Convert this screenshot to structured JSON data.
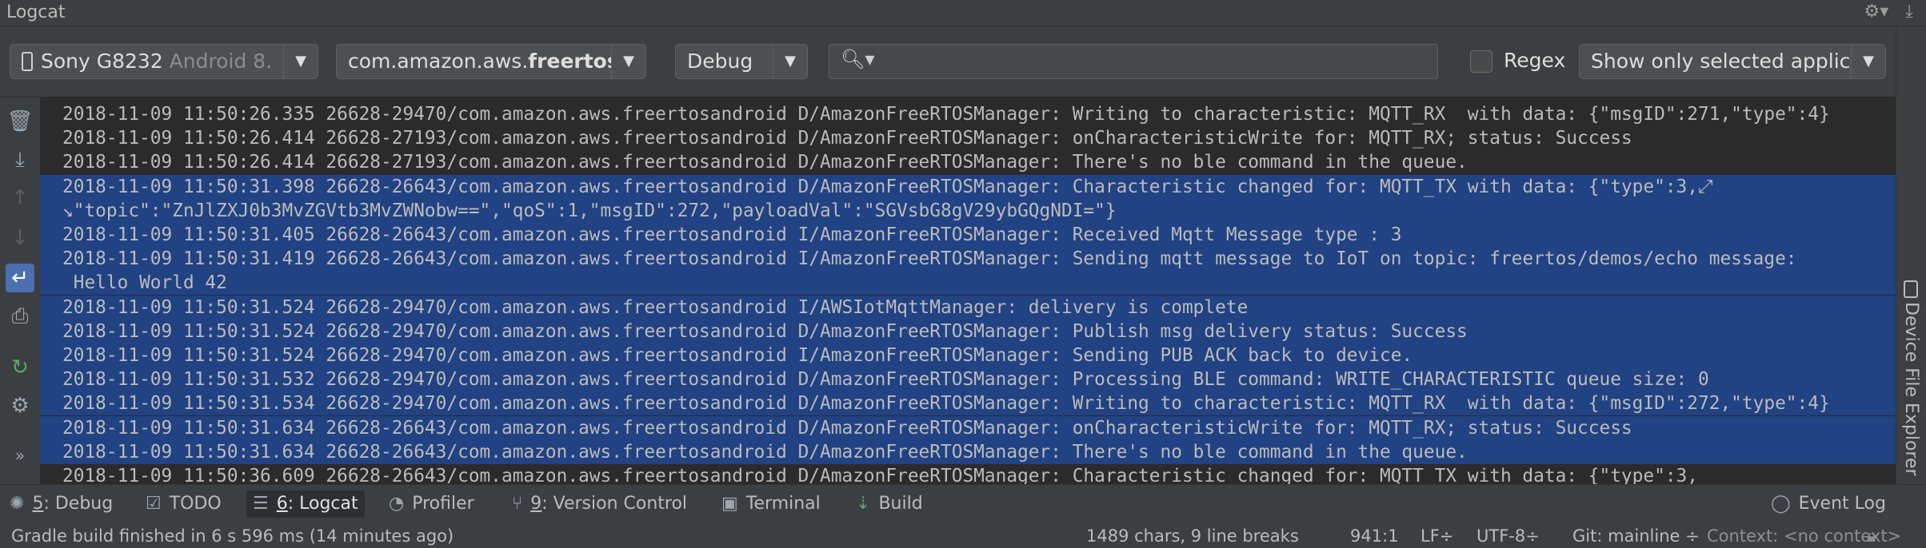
{
  "window": {
    "title": "Logcat"
  },
  "filters": {
    "device": {
      "name": "Sony G8232",
      "api": "Android 8."
    },
    "process": {
      "prefix": "com.amazon.aws.",
      "bold": "freertos"
    },
    "level": "Debug",
    "search_placeholder": "",
    "regex_label": "Regex",
    "scope": "Show only selected applica"
  },
  "log_lines": [
    {
      "text": "2018-11-09 11:50:26.335 26628-29470/com.amazon.aws.freertosandroid D/AmazonFreeRTOSManager: Writing to characteristic: MQTT_RX  with data: {\"msgID\":271,\"type\":4}",
      "selected": false
    },
    {
      "text": "2018-11-09 11:50:26.414 26628-27193/com.amazon.aws.freertosandroid D/AmazonFreeRTOSManager: onCharacteristicWrite for: MQTT_RX; status: Success",
      "selected": false
    },
    {
      "text": "2018-11-09 11:50:26.414 26628-27193/com.amazon.aws.freertosandroid D/AmazonFreeRTOSManager: There's no ble command in the queue.",
      "selected": false
    },
    {
      "text": "2018-11-09 11:50:31.398 26628-26643/com.amazon.aws.freertosandroid D/AmazonFreeRTOSManager: Characteristic changed for: MQTT_TX with data: {\"type\":3,⤢",
      "selected": true
    },
    {
      "text": "↘\"topic\":\"ZnJlZXJ0b3MvZGVtb3MvZWNobw==\",\"qoS\":1,\"msgID\":272,\"payloadVal\":\"SGVsbG8gV29ybGQgNDI=\"}",
      "selected": true
    },
    {
      "text": "2018-11-09 11:50:31.405 26628-26643/com.amazon.aws.freertosandroid I/AmazonFreeRTOSManager: Received Mqtt Message type : 3",
      "selected": true
    },
    {
      "text": "2018-11-09 11:50:31.419 26628-26643/com.amazon.aws.freertosandroid I/AmazonFreeRTOSManager: Sending mqtt message to IoT on topic: freertos/demos/echo message:",
      "selected": true
    },
    {
      "text": " Hello World 42",
      "selected": true
    },
    {
      "text": "2018-11-09 11:50:31.524 26628-29470/com.amazon.aws.freertosandroid I/AWSIotMqttManager: delivery is complete",
      "selected": true
    },
    {
      "text": "2018-11-09 11:50:31.524 26628-29470/com.amazon.aws.freertosandroid D/AmazonFreeRTOSManager: Publish msg delivery status: Success",
      "selected": true
    },
    {
      "text": "2018-11-09 11:50:31.524 26628-29470/com.amazon.aws.freertosandroid I/AmazonFreeRTOSManager: Sending PUB ACK back to device.",
      "selected": true
    },
    {
      "text": "2018-11-09 11:50:31.532 26628-29470/com.amazon.aws.freertosandroid D/AmazonFreeRTOSManager: Processing BLE command: WRITE_CHARACTERISTIC queue size: 0",
      "selected": true
    },
    {
      "text": "2018-11-09 11:50:31.534 26628-29470/com.amazon.aws.freertosandroid D/AmazonFreeRTOSManager: Writing to characteristic: MQTT_RX  with data: {\"msgID\":272,\"type\":4}",
      "selected": true
    },
    {
      "text": "2018-11-09 11:50:31.634 26628-26643/com.amazon.aws.freertosandroid D/AmazonFreeRTOSManager: onCharacteristicWrite for: MQTT_RX; status: Success",
      "selected": true
    },
    {
      "text": "2018-11-09 11:50:31.634 26628-26643/com.amazon.aws.freertosandroid D/AmazonFreeRTOSManager: There's no ble command in the queue.",
      "selected": true
    },
    {
      "text": "2018-11-09 11:50:36.609 26628-26643/com.amazon.aws.freertosandroid D/AmazonFreeRTOSManager: Characteristic changed for: MQTT_TX with data: {\"type\":3,",
      "selected": false
    }
  ],
  "right_panel": {
    "label": "Device File Explorer"
  },
  "tool_windows": {
    "debug": {
      "num": "5",
      "label": ": Debug"
    },
    "todo": "TODO",
    "logcat": {
      "num": "6",
      "label": ": Logcat"
    },
    "profiler": "Profiler",
    "version_control": {
      "num": "9",
      "label": ": Version Control"
    },
    "terminal": "Terminal",
    "build": "Build",
    "event_log": "Event Log"
  },
  "status": {
    "message": "Gradle build finished in 6 s 596 ms (14 minutes ago)",
    "selection": "1489 chars, 9 line breaks",
    "position": "941:1",
    "line_sep": "LF÷",
    "encoding": "UTF-8÷",
    "git": "Git: mainline ÷",
    "context": "Context: <no context>"
  },
  "icons": {
    "gear": "gear-icon",
    "minimize": "minimize-icon",
    "phone": "phone-icon",
    "search": "search-icon",
    "trash": "trash-icon",
    "scroll_end": "scroll-to-end-icon",
    "up": "up-arrow-icon",
    "down": "down-arrow-icon",
    "soft_wrap": "soft-wrap-icon",
    "print": "print-icon",
    "restart": "restart-icon",
    "settings": "settings-icon",
    "more": "more-icon",
    "folder": "folder-icon"
  }
}
